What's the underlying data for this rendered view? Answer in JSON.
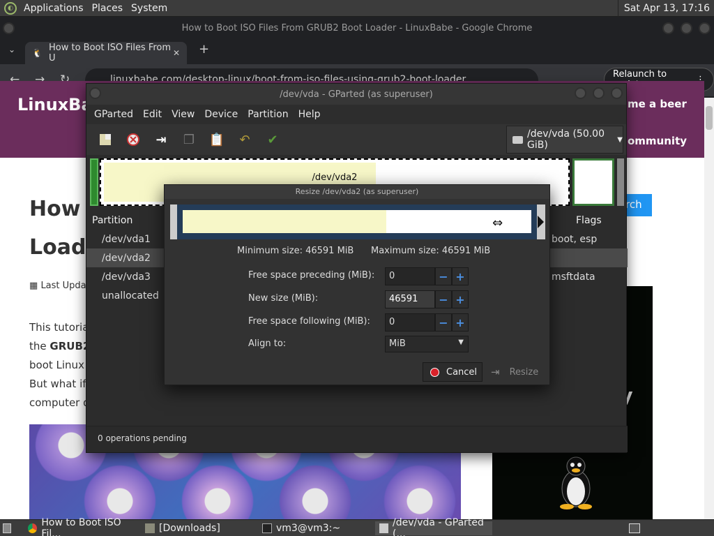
{
  "system_panel": {
    "menus": [
      "Applications",
      "Places",
      "System"
    ],
    "clock": "Sat Apr 13, 17:16"
  },
  "chrome": {
    "window_title": "How to Boot ISO Files From GRUB2 Boot Loader - LinuxBabe - Google Chrome",
    "tab_label": "How to Boot ISO Files From U",
    "url": "linuxbabe.com/desktop-linux/boot-from-iso-files-using-grub2-boot-loader",
    "relaunch_label": "Relaunch to update"
  },
  "webpage": {
    "logo": "LinuxBa",
    "nav_1": "me a beer",
    "nav_2": "ommunity",
    "heading_1": "How t",
    "heading_2": "Loade",
    "last_updated": "Last Updat",
    "search_label": "rch",
    "para_1": "This tutoria",
    "para_2_prefix": "the",
    "para_2_bold": "GRUB2",
    "para_3": "boot Linux",
    "para_4": "But what if",
    "para_5": "computer d",
    "ad_text": "ty"
  },
  "gparted": {
    "title": "/dev/vda - GParted (as superuser)",
    "menu": [
      "GParted",
      "Edit",
      "View",
      "Device",
      "Partition",
      "Help"
    ],
    "device": "/dev/vda (50.00 GiB)",
    "map_label": "/dev/vda2",
    "columns": {
      "partition": "Partition",
      "flags": "Flags"
    },
    "rows": [
      {
        "name": "/dev/vda1",
        "flags": "boot, esp"
      },
      {
        "name": "/dev/vda2",
        "flags": ""
      },
      {
        "name": "/dev/vda3",
        "flags": "msftdata"
      },
      {
        "name": "unallocated",
        "flags": ""
      }
    ],
    "status": "0 operations pending"
  },
  "resize_dialog": {
    "title": "Resize /dev/vda2 (as superuser)",
    "min_size": "Minimum size: 46591 MiB",
    "max_size": "Maximum size: 46591 MiB",
    "free_preceding_label": "Free space preceding (MiB):",
    "free_preceding_value": "0",
    "new_size_label": "New size (MiB):",
    "new_size_value": "46591",
    "free_following_label": "Free space following (MiB):",
    "free_following_value": "0",
    "align_label": "Align to:",
    "align_value": "MiB",
    "cancel_label": "Cancel",
    "resize_label": "Resize"
  },
  "taskbar": {
    "tasks": [
      "How to Boot ISO Fil...",
      "[Downloads]",
      "vm3@vm3:~",
      "/dev/vda - GParted (..."
    ]
  },
  "colors": {
    "accent_blue": "#4b8fe0",
    "site_header": "#6b2d5c",
    "cancel_red": "#d9222a",
    "used_space": "#f7f7c8"
  }
}
